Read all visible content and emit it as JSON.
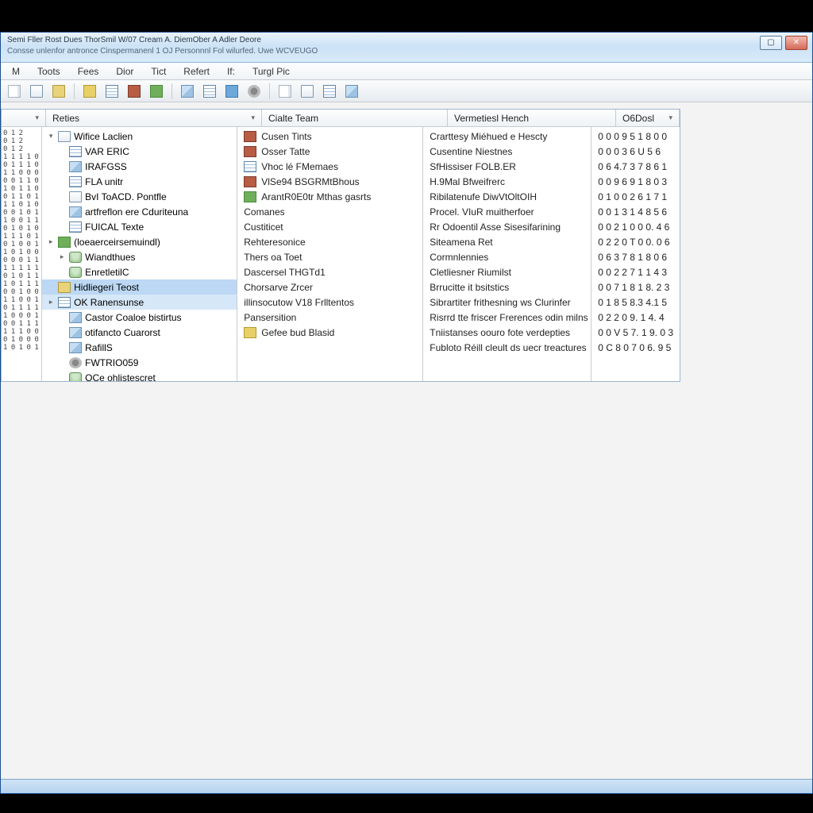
{
  "titlebar": {
    "line1": "Semi Fller Rost Dues ThorSmil W/07 Cream A.  DiemOber A Adler Deore",
    "line2": "Consse unlenfor antronce  Cinspermanenl  1 OJ Personnnl Fol wilurfed. Uwe WCVEUGO"
  },
  "menu": {
    "items": [
      "M",
      "Toots",
      "Fees",
      "Dior",
      "Tict",
      "Refert",
      "If:",
      "Turgl Pic"
    ]
  },
  "headers": {
    "narrow": "",
    "tree": "Reties",
    "c1": "Cialte Team",
    "c2": "Vermetiesl Hench",
    "c3": "O6Dosl"
  },
  "narrow_text": "0 1 2\n0 1 2\n0 1 2\n1 1 1 1 0\n0 1 1 1 0\n1 1 0 0 0\n0 0 1 1 0\n1 0 1 1 0\n0 1 1 0 1\n1 1 0 1 0\n0 0 1 0 1\n1 0 0 1 1\n0 1 0 1 0\n1 1 1 0 1\n0 1 0 0 1\n1 0 1 0 0\n0 0 0 1 1\n1 1 1 1 1\n0 1 0 1 1\n1 0 1 1 1\n0 0 1 0 0\n1 1 0 0 1\n0 1 1 1 1\n1 0 0 0 1\n0 0 1 1 1\n1 1 1 0 0\n0 1 0 0 0\n1 0 1 0 1",
  "tree": {
    "items": [
      {
        "label": "Wifice Laclien",
        "icon": "ico-doc",
        "indent": 0,
        "arrow": "▾"
      },
      {
        "label": "VAR ERIC",
        "icon": "ico-tbl",
        "indent": 1
      },
      {
        "label": "IRAFGSS",
        "icon": "ico-cube",
        "indent": 1
      },
      {
        "label": "FLA unitr",
        "icon": "ico-tbl",
        "indent": 1
      },
      {
        "label": "BvI  ToACD. Pontfle",
        "icon": "ico-doc",
        "indent": 1
      },
      {
        "label": "artfreflon ere Cduriteuna",
        "icon": "ico-cube",
        "indent": 1
      },
      {
        "label": "FUICAL Texte",
        "icon": "ico-tbl",
        "indent": 1
      },
      {
        "label": "(loeaerceirsemuindl)",
        "icon": "ico-green",
        "indent": 0,
        "arrow": "▸"
      },
      {
        "label": "Wiandthues",
        "icon": "ico-db",
        "indent": 1,
        "arrow": "▸"
      },
      {
        "label": "EnretletilC",
        "icon": "ico-db",
        "indent": 1
      },
      {
        "label": "Hidliegeri Teost",
        "icon": "ico-folder",
        "indent": 0,
        "sel": true
      },
      {
        "label": "OK Ranensunse",
        "icon": "ico-tbl",
        "indent": 0,
        "sel2": true,
        "arrow": "▸"
      },
      {
        "label": "Castor Coaloe bistirtus",
        "icon": "ico-cube",
        "indent": 1
      },
      {
        "label": "otifancto Cuarorst",
        "icon": "ico-cube",
        "indent": 1
      },
      {
        "label": "RafillS",
        "icon": "ico-cube",
        "indent": 1
      },
      {
        "label": "FWTRIO059",
        "icon": "ico-gear",
        "indent": 1
      },
      {
        "label": "OCe ohlistescret",
        "icon": "ico-db",
        "indent": 1
      }
    ]
  },
  "list_c1": [
    {
      "label": "Cusen Tints",
      "icon": "ico-brick"
    },
    {
      "label": "Osser Tatte",
      "icon": "ico-brick"
    },
    {
      "label": "Vhoc lé FMemaes",
      "icon": "ico-tbl"
    },
    {
      "label": "VlSe94 BSGRMtBhous",
      "icon": "ico-brick"
    },
    {
      "label": "ArantR0E0tr Mthas gasrts",
      "icon": "ico-green"
    },
    {
      "label": "Comanes",
      "icon": ""
    },
    {
      "label": "Custiticet",
      "icon": ""
    },
    {
      "label": "Rehteresonice",
      "icon": ""
    },
    {
      "label": "Thers oa Toet",
      "icon": ""
    },
    {
      "label": "Dascersel THGTd1",
      "icon": ""
    },
    {
      "label": "Chorsarve Zrcer",
      "icon": ""
    },
    {
      "label": "illinsocutow V18 Frlltentos",
      "icon": ""
    },
    {
      "label": "Pansersition",
      "icon": ""
    },
    {
      "label": "Gefee bud Blasid",
      "icon": "ico-yellow"
    }
  ],
  "list_c2": [
    "Crarttesy Miéhued e Hescty",
    "Cusentine Niestnes",
    "SfHissiser FOLB.ER",
    "H.9Mal Bfweifrerc",
    "Ribilatenufe  DiwVtOltOIH",
    "Procel. VIuR muitherfoer",
    "Rr Odoentil Asse Sisesifarining",
    "Siteamena Ret",
    "Cormnlennies",
    "Cletliesner Riumilst",
    "Brrucitte it bsitstics",
    "Sibrartiter frithesning  ws Clurinfer",
    "Risrrd tte friscer Frerences odin milns",
    "Tniistanses oouro  fote verdepties",
    "Fubloto Réill cleult ds uecr treactures"
  ],
  "list_c3": [
    "0 0 0 9 5 1 8 0 0",
    "0 0 0 3 6 U 5 6",
    "0 6 4.7 3 7 8 6 1",
    "0 0 9 6 9 1 8 0 3",
    "0 1 0 0 2 6 1 7 1",
    "0 0 1 3 1 4 8 5 6",
    "0 0 2 1 0 0 0. 4 6",
    "0 2 2 0 T 0 0. 0 6",
    "0 6 3 7 8 1 8 0 6",
    "0 0 2 2 7 1 1 4 3",
    "0 0 7 1 8 1 8. 2 3",
    "0 1 8 5 8.3 4.1 5",
    "0 2 2 0 9. 1 4. 4",
    "0 0 V 5 7. 1 9. 0 3",
    "0 C 8 0 7 0 6. 9 5"
  ]
}
